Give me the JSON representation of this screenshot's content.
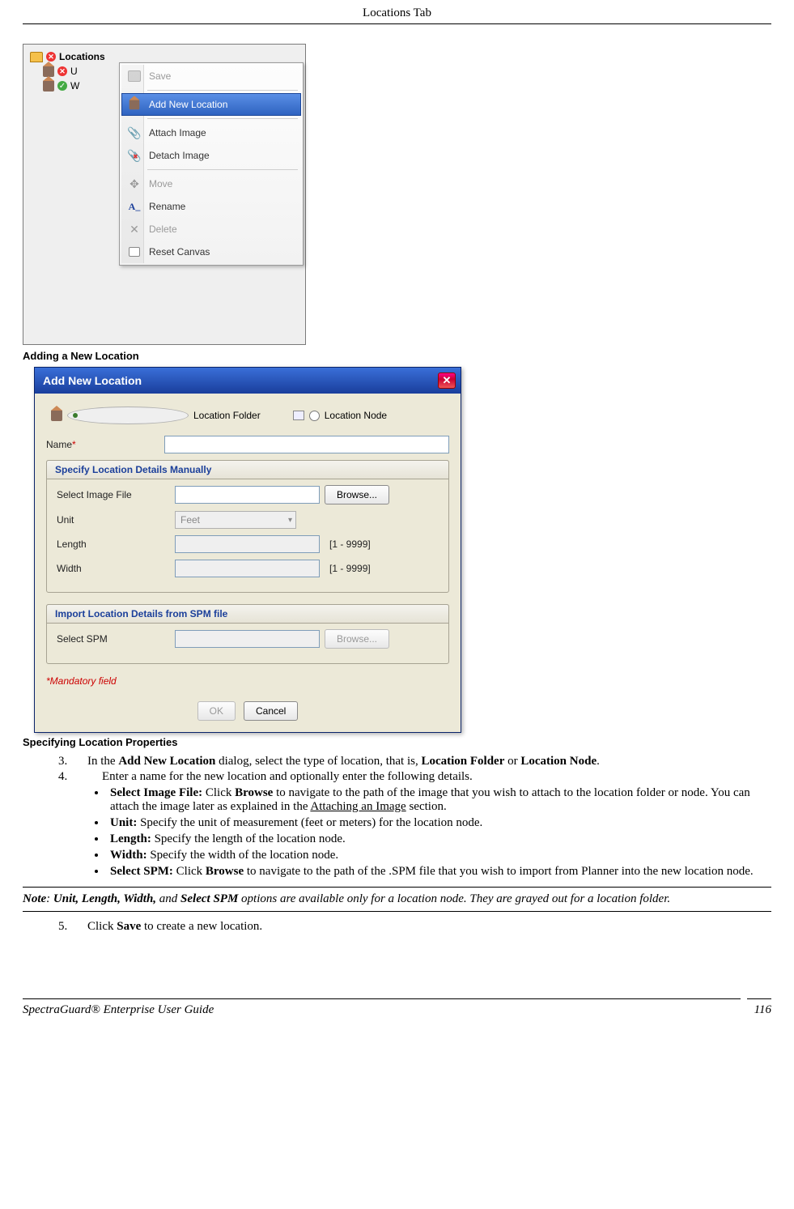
{
  "header": {
    "title": "Locations Tab"
  },
  "shot1": {
    "root_label": "Locations",
    "child1": "U",
    "child2": "W",
    "menu": {
      "save": "Save",
      "add": "Add New Location",
      "attach": "Attach Image",
      "detach": "Detach Image",
      "move": "Move",
      "rename": "Rename",
      "delete": "Delete",
      "reset": "Reset Canvas"
    }
  },
  "caption1": "Adding a New Location",
  "dlg": {
    "title": "Add New Location",
    "opt_folder": "Location Folder",
    "opt_node": "Location Node",
    "name_label": "Name",
    "group1_title": "Specify Location Details Manually",
    "sel_image": "Select Image File",
    "browse": "Browse...",
    "unit_label": "Unit",
    "unit_value": "Feet",
    "length_label": "Length",
    "range": "[1 - 9999]",
    "width_label": "Width",
    "group2_title": "Import Location Details from SPM file",
    "sel_spm": "Select SPM",
    "mandatory": "*Mandatory field",
    "ok": "OK",
    "cancel": "Cancel"
  },
  "caption2": "Specifying Location Properties",
  "steps": {
    "n3": "3.",
    "t3a": "In the ",
    "t3b": "Add New Location",
    "t3c": " dialog, select the type of location, that is, ",
    "t3d": "Location Folder",
    "t3e": " or ",
    "t3f": "Location Node",
    "t3g": ".",
    "n4": "4.",
    "t4": "Enter a name for the new location and optionally enter the following details.",
    "b1a": "Select Image File:",
    "b1b": " Click ",
    "b1c": "Browse",
    "b1d": " to navigate to the path of the image that you wish to attach to the location folder or node. You can attach the image later as explained in the ",
    "b1e": "Attaching an Image",
    "b1f": " section.",
    "b2a": "Unit:",
    "b2b": " Specify the unit of measurement (feet or meters) for the location node.",
    "b3a": "Length:",
    "b3b": " Specify the length of the location node.",
    "b4a": "Width:",
    "b4b": " Specify the width of the location node.",
    "b5a": "Select SPM:",
    "b5b": " Click ",
    "b5c": "Browse",
    "b5d": " to navigate to the path of the .SPM file that you wish to import from Planner into the new location node.",
    "n5": "5.",
    "t5a": "Click ",
    "t5b": "Save",
    "t5c": " to create a new location."
  },
  "note": {
    "pre": "Note",
    "mid1": ": ",
    "b1": "Unit, Length, Width,",
    "mid2": " and ",
    "b2": "Select SPM",
    "post": " options are available only for a location node. They are grayed out for a location folder."
  },
  "footer": {
    "left": "SpectraGuard®  Enterprise User Guide",
    "right": "116"
  }
}
